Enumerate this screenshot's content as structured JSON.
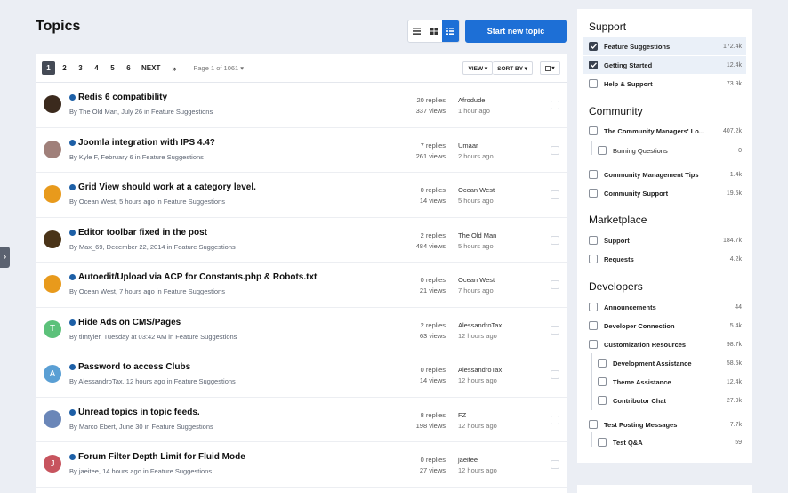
{
  "page": {
    "title": "Topics",
    "start_button": "Start new topic",
    "side_toggle": "›"
  },
  "pagination": {
    "pages": [
      "1",
      "2",
      "3",
      "4",
      "5",
      "6"
    ],
    "next": "NEXT",
    "last": "»",
    "page_of": "Page 1 of 1061 ▾",
    "view_btn": "VIEW ▾",
    "sort_btn": "SORT BY ▾",
    "select_btn": "▾"
  },
  "colors": {
    "accent": "#1d6fd6",
    "unread_dot": "#1d5fa6"
  },
  "topics": [
    {
      "title": "Redis 6 compatibility",
      "meta": "By The Old Man, July 26 in Feature Suggestions",
      "replies": "20 replies",
      "views": "337 views",
      "last_user": "Afrodude",
      "last_time": "1 hour ago",
      "avatar_letter": "",
      "avatar_color": "#3b2a1d"
    },
    {
      "title": "Joomla integration with IPS 4.4?",
      "meta": "By Kyle F, February 6 in Feature Suggestions",
      "replies": "7 replies",
      "views": "261 views",
      "last_user": "Umaar",
      "last_time": "2 hours ago",
      "avatar_letter": "",
      "avatar_color": "#a0807a"
    },
    {
      "title": "Grid View should work at a category level.",
      "meta": "By Ocean West, 5 hours ago in Feature Suggestions",
      "replies": "0 replies",
      "views": "14 views",
      "last_user": "Ocean West",
      "last_time": "5 hours ago",
      "avatar_letter": "",
      "avatar_color": "#e89a1c"
    },
    {
      "title": "Editor toolbar fixed in the post",
      "meta": "By Max_69, December 22, 2014 in Feature Suggestions",
      "replies": "2 replies",
      "views": "484 views",
      "last_user": "The Old Man",
      "last_time": "5 hours ago",
      "avatar_letter": "",
      "avatar_color": "#4a3418"
    },
    {
      "title": "Autoedit/Upload via ACP for Constants.php & Robots.txt",
      "meta": "By Ocean West, 7 hours ago in Feature Suggestions",
      "replies": "0 replies",
      "views": "21 views",
      "last_user": "Ocean West",
      "last_time": "7 hours ago",
      "avatar_letter": "",
      "avatar_color": "#e89a1c"
    },
    {
      "title": "Hide Ads on CMS/Pages",
      "meta": "By timtyler, Tuesday at 03:42 AM in Feature Suggestions",
      "replies": "2 replies",
      "views": "63 views",
      "last_user": "AlessandroTax",
      "last_time": "12 hours ago",
      "avatar_letter": "T",
      "avatar_color": "#5cc17a"
    },
    {
      "title": "Password to access Clubs",
      "meta": "By AlessandroTax, 12 hours ago in Feature Suggestions",
      "replies": "0 replies",
      "views": "14 views",
      "last_user": "AlessandroTax",
      "last_time": "12 hours ago",
      "avatar_letter": "A",
      "avatar_color": "#5a9fd4"
    },
    {
      "title": "Unread topics in topic feeds.",
      "meta": "By Marco Ebert, June 30 in Feature Suggestions",
      "replies": "8 replies",
      "views": "198 views",
      "last_user": "FZ",
      "last_time": "12 hours ago",
      "avatar_letter": "",
      "avatar_color": "#6a86b8"
    },
    {
      "title": "Forum Filter Depth Limit for Fluid Mode",
      "meta": "By jaeitee, 14 hours ago in Feature Suggestions",
      "replies": "0 replies",
      "views": "27 views",
      "last_user": "jaeitee",
      "last_time": "12 hours ago",
      "avatar_letter": "J",
      "avatar_color": "#c7545e"
    }
  ],
  "sidebar": {
    "sections": [
      {
        "title": "Support"
      },
      {
        "title": "Community"
      },
      {
        "title": "Marketplace"
      },
      {
        "title": "Developers"
      }
    ],
    "items": [
      {
        "label": "Feature Suggestions",
        "count": "172.4k",
        "checked": true
      },
      {
        "label": "Getting Started",
        "count": "12.4k",
        "checked": true
      },
      {
        "label": "Help & Support",
        "count": "73.9k",
        "checked": false
      },
      {
        "label": "The Community Managers' Lo...",
        "count": "407.2k",
        "checked": false
      },
      {
        "label": "Burning Questions",
        "count": "0",
        "checked": false
      },
      {
        "label": "Community Management Tips",
        "count": "1.4k",
        "checked": false
      },
      {
        "label": "Community Support",
        "count": "19.5k",
        "checked": false
      },
      {
        "label": "Support",
        "count": "184.7k",
        "checked": false
      },
      {
        "label": "Requests",
        "count": "4.2k",
        "checked": false
      },
      {
        "label": "Announcements",
        "count": "44",
        "checked": false
      },
      {
        "label": "Developer Connection",
        "count": "5.4k",
        "checked": false
      },
      {
        "label": "Customization Resources",
        "count": "98.7k",
        "checked": false
      },
      {
        "label": "Development Assistance",
        "count": "58.5k",
        "checked": false
      },
      {
        "label": "Theme Assistance",
        "count": "12.4k",
        "checked": false
      },
      {
        "label": "Contributor Chat",
        "count": "27.9k",
        "checked": false
      },
      {
        "label": "Test Posting Messages",
        "count": "7.7k",
        "checked": false
      },
      {
        "label": "Test Q&A",
        "count": "59",
        "checked": false
      }
    ]
  }
}
